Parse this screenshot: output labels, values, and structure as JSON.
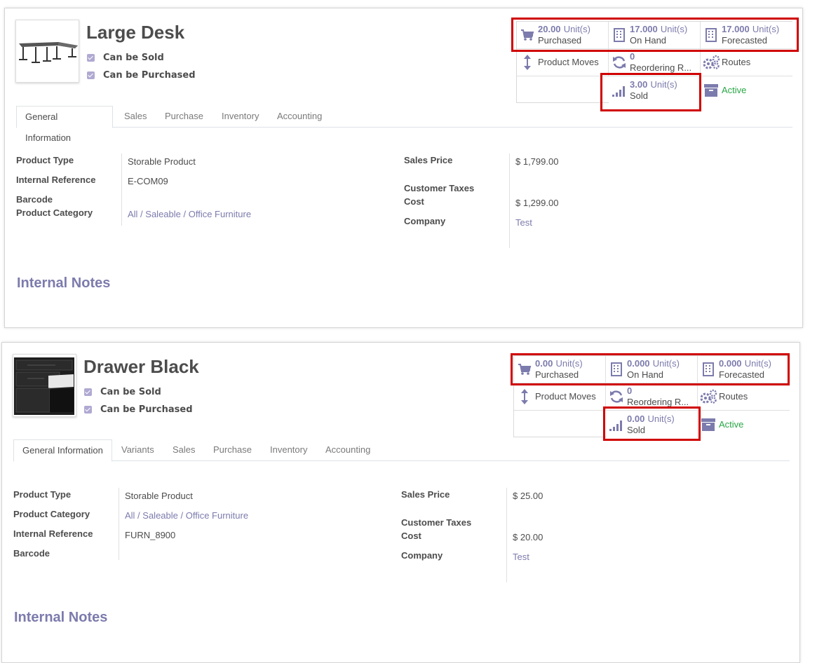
{
  "colors": {
    "accent": "#7c7bad",
    "highlight": "#d00000",
    "active_green": "#28a745",
    "text": "#4c4c4c"
  },
  "products": [
    {
      "name": "Large Desk",
      "image_icon": "desk-image",
      "can_be_sold_label": "Can be Sold",
      "can_be_purchased_label": "Can be Purchased",
      "stats": {
        "purchased_value": "20.00",
        "purchased_unit": "Unit(s)",
        "purchased_label": "Purchased",
        "on_hand_value": "17.000",
        "on_hand_unit": "Unit(s)",
        "on_hand_label": "On Hand",
        "forecasted_value": "17.000",
        "forecasted_unit": "Unit(s)",
        "forecasted_label": "Forecasted",
        "product_moves_label": "Product Moves",
        "reordering_count": "0",
        "reordering_label": "Reordering R...",
        "routes_label": "Routes",
        "sold_value": "3.00",
        "sold_unit": "Unit(s)",
        "sold_label": "Sold",
        "active_label": "Active"
      },
      "tabs": [
        "General Information",
        "Sales",
        "Purchase",
        "Inventory",
        "Accounting"
      ],
      "fields": {
        "product_type_label": "Product Type",
        "product_type_value": "Storable Product",
        "internal_ref_label": "Internal Reference",
        "internal_ref_value": "E-COM09",
        "barcode_label": "Barcode",
        "category_label": "Product Category",
        "category_value": "All / Saleable / Office Furniture",
        "sales_price_label": "Sales Price",
        "sales_price_value": "$ 1,799.00",
        "customer_taxes_label": "Customer Taxes",
        "cost_label": "Cost",
        "cost_value": "$ 1,299.00",
        "company_label": "Company",
        "company_value": "Test"
      },
      "notes_title": "Internal Notes"
    },
    {
      "name": "Drawer Black",
      "image_icon": "drawer-image",
      "can_be_sold_label": "Can be Sold",
      "can_be_purchased_label": "Can be Purchased",
      "stats": {
        "purchased_value": "0.00",
        "purchased_unit": "Unit(s)",
        "purchased_label": "Purchased",
        "on_hand_value": "0.000",
        "on_hand_unit": "Unit(s)",
        "on_hand_label": "On Hand",
        "forecasted_value": "0.000",
        "forecasted_unit": "Unit(s)",
        "forecasted_label": "Forecasted",
        "product_moves_label": "Product Moves",
        "reordering_count": "0",
        "reordering_label": "Reordering R...",
        "routes_label": "Routes",
        "sold_value": "0.00",
        "sold_unit": "Unit(s)",
        "sold_label": "Sold",
        "active_label": "Active"
      },
      "tabs": [
        "General Information",
        "Variants",
        "Sales",
        "Purchase",
        "Inventory",
        "Accounting"
      ],
      "fields": {
        "product_type_label": "Product Type",
        "product_type_value": "Storable Product",
        "category_label": "Product Category",
        "category_value": "All / Saleable / Office Furniture",
        "internal_ref_label": "Internal Reference",
        "internal_ref_value": "FURN_8900",
        "barcode_label": "Barcode",
        "sales_price_label": "Sales Price",
        "sales_price_value": "$ 25.00",
        "customer_taxes_label": "Customer Taxes",
        "cost_label": "Cost",
        "cost_value": "$ 20.00",
        "company_label": "Company",
        "company_value": "Test"
      },
      "notes_title": "Internal Notes"
    }
  ]
}
